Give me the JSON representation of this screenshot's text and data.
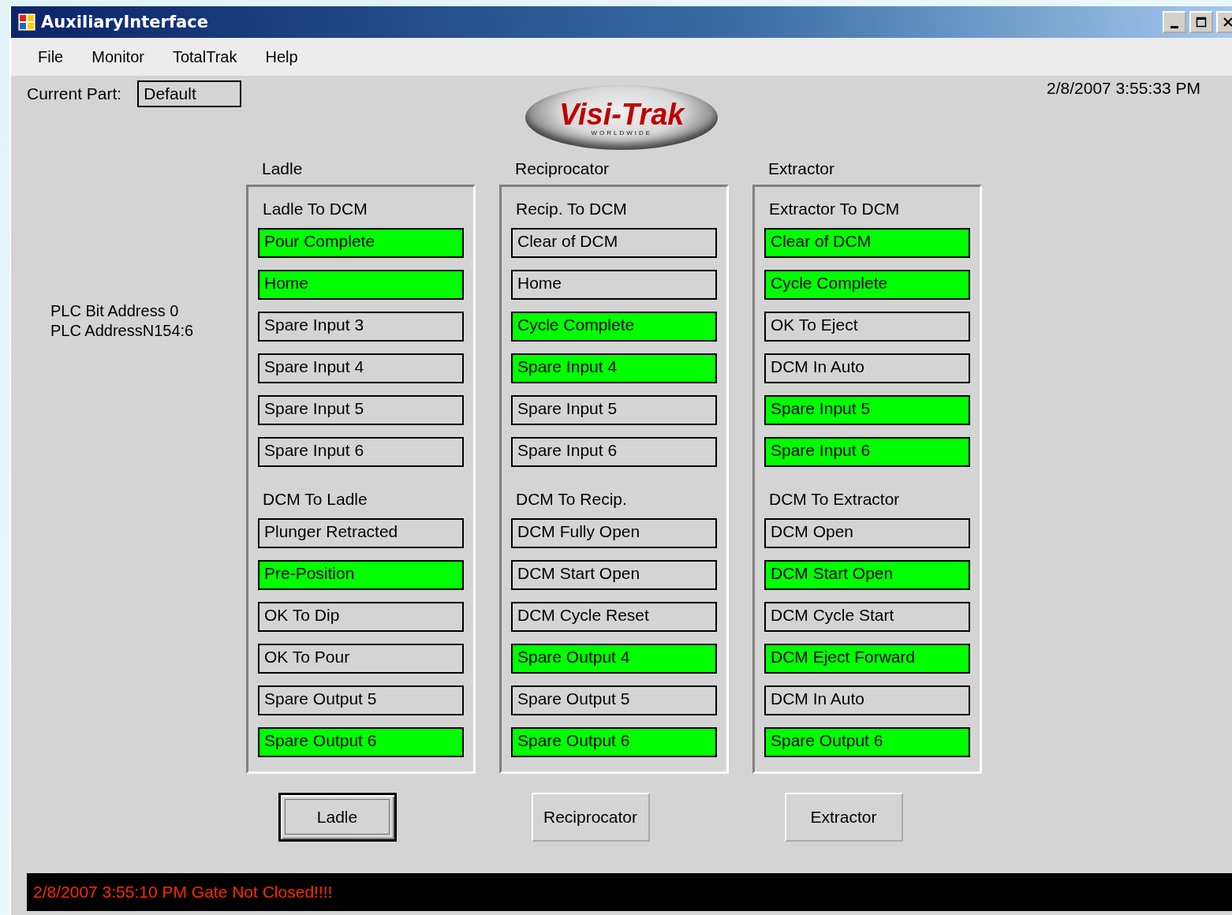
{
  "window": {
    "title": "AuxiliaryInterface"
  },
  "menu": [
    "File",
    "Monitor",
    "TotalTrak",
    "Help"
  ],
  "current_part": {
    "label": "Current Part:",
    "value": "Default"
  },
  "logo": {
    "text": "Visi-Trak",
    "subtext": "WORLDWIDE"
  },
  "datetime": "2/8/2007 3:55:33 PM",
  "plc_info": [
    "PLC Bit Address 0",
    "PLC AddressN154:6"
  ],
  "panels": [
    {
      "title": "Ladle",
      "sections": [
        {
          "title": "Ladle To DCM",
          "signals": [
            {
              "label": "Pour Complete",
              "on": true
            },
            {
              "label": "Home",
              "on": true
            },
            {
              "label": "Spare Input 3",
              "on": false
            },
            {
              "label": "Spare Input 4",
              "on": false
            },
            {
              "label": "Spare Input 5",
              "on": false
            },
            {
              "label": "Spare Input 6",
              "on": false
            }
          ]
        },
        {
          "title": "DCM To Ladle",
          "signals": [
            {
              "label": "Plunger Retracted",
              "on": false
            },
            {
              "label": "Pre-Position",
              "on": true
            },
            {
              "label": "OK To Dip",
              "on": false
            },
            {
              "label": "OK To Pour",
              "on": false
            },
            {
              "label": "Spare Output 5",
              "on": false
            },
            {
              "label": "Spare Output 6",
              "on": true
            }
          ]
        }
      ]
    },
    {
      "title": "Reciprocator",
      "sections": [
        {
          "title": "Recip. To DCM",
          "signals": [
            {
              "label": "Clear of DCM",
              "on": false
            },
            {
              "label": "Home",
              "on": false
            },
            {
              "label": "Cycle Complete",
              "on": true
            },
            {
              "label": "Spare Input 4",
              "on": true
            },
            {
              "label": "Spare Input 5",
              "on": false
            },
            {
              "label": "Spare Input 6",
              "on": false
            }
          ]
        },
        {
          "title": "DCM To Recip.",
          "signals": [
            {
              "label": "DCM Fully Open",
              "on": false
            },
            {
              "label": "DCM Start Open",
              "on": false
            },
            {
              "label": "DCM Cycle Reset",
              "on": false
            },
            {
              "label": "Spare Output 4",
              "on": true
            },
            {
              "label": "Spare Output 5",
              "on": false
            },
            {
              "label": "Spare Output 6",
              "on": true
            }
          ]
        }
      ]
    },
    {
      "title": "Extractor",
      "sections": [
        {
          "title": "Extractor To DCM",
          "signals": [
            {
              "label": "Clear of DCM",
              "on": true
            },
            {
              "label": "Cycle Complete",
              "on": true
            },
            {
              "label": "OK To Eject",
              "on": false
            },
            {
              "label": "DCM In Auto",
              "on": false
            },
            {
              "label": "Spare Input 5",
              "on": true
            },
            {
              "label": "Spare Input 6",
              "on": true
            }
          ]
        },
        {
          "title": "DCM To Extractor",
          "signals": [
            {
              "label": "DCM Open",
              "on": false
            },
            {
              "label": "DCM Start Open",
              "on": true
            },
            {
              "label": "DCM Cycle Start",
              "on": false
            },
            {
              "label": "DCM Eject Forward",
              "on": true
            },
            {
              "label": "DCM In Auto",
              "on": false
            },
            {
              "label": "Spare Output 6",
              "on": true
            }
          ]
        }
      ]
    }
  ],
  "buttons": [
    {
      "label": "Ladle",
      "focused": true
    },
    {
      "label": "Reciprocator",
      "focused": false
    },
    {
      "label": "Extractor",
      "focused": false
    }
  ],
  "status": {
    "message": "2/8/2007 3:55:10 PM Gate Not Closed!!!!"
  }
}
